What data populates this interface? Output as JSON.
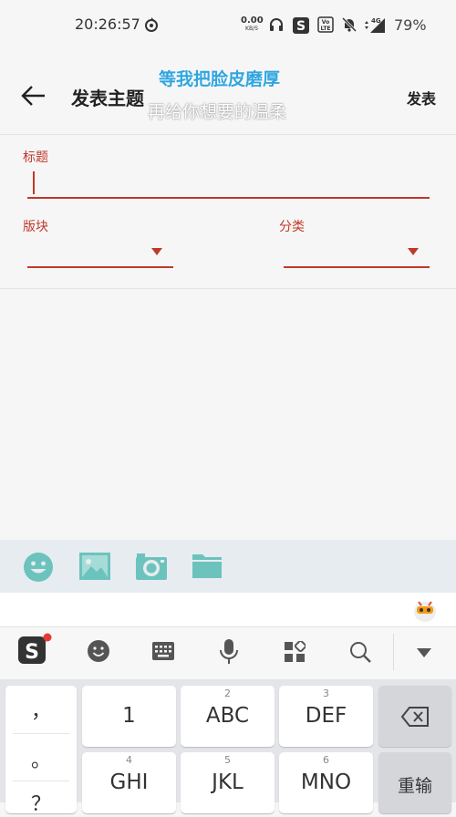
{
  "status_bar": {
    "time": "20:26:57",
    "net_speed_value": "0.00",
    "net_speed_unit": "KB/S",
    "battery": "79%",
    "signal_tag": "4G",
    "volte_label_1": "Vo",
    "volte_label_2": "LTE"
  },
  "app_bar": {
    "title": "发表主题",
    "publish_label": "发表",
    "lyric_line_1": "等我把脸皮磨厚",
    "lyric_line_2": "再给你想要的温柔"
  },
  "form": {
    "title_label": "标题",
    "title_value": "",
    "section_label": "版块",
    "section_value": "",
    "category_label": "分类",
    "category_value": ""
  },
  "attachments": {
    "icons": [
      "smiley-icon",
      "image-icon",
      "camera-icon",
      "folder-icon"
    ],
    "accent_color": "#6cc3bd"
  },
  "keyboard": {
    "toolbar_icons": [
      "sogou-logo-icon",
      "emoji-icon",
      "keyboard-icon",
      "microphone-icon",
      "apps-grid-icon",
      "search-icon",
      "collapse-icon"
    ],
    "punct_keys": [
      "，",
      "。",
      "？"
    ],
    "keys_row1": [
      {
        "sub": "",
        "label": "1"
      },
      {
        "sub": "2",
        "label": "ABC"
      },
      {
        "sub": "3",
        "label": "DEF"
      }
    ],
    "keys_row2": [
      {
        "sub": "4",
        "label": "GHI"
      },
      {
        "sub": "5",
        "label": "JKL"
      },
      {
        "sub": "6",
        "label": "MNO"
      }
    ],
    "retype_label": "重输"
  }
}
